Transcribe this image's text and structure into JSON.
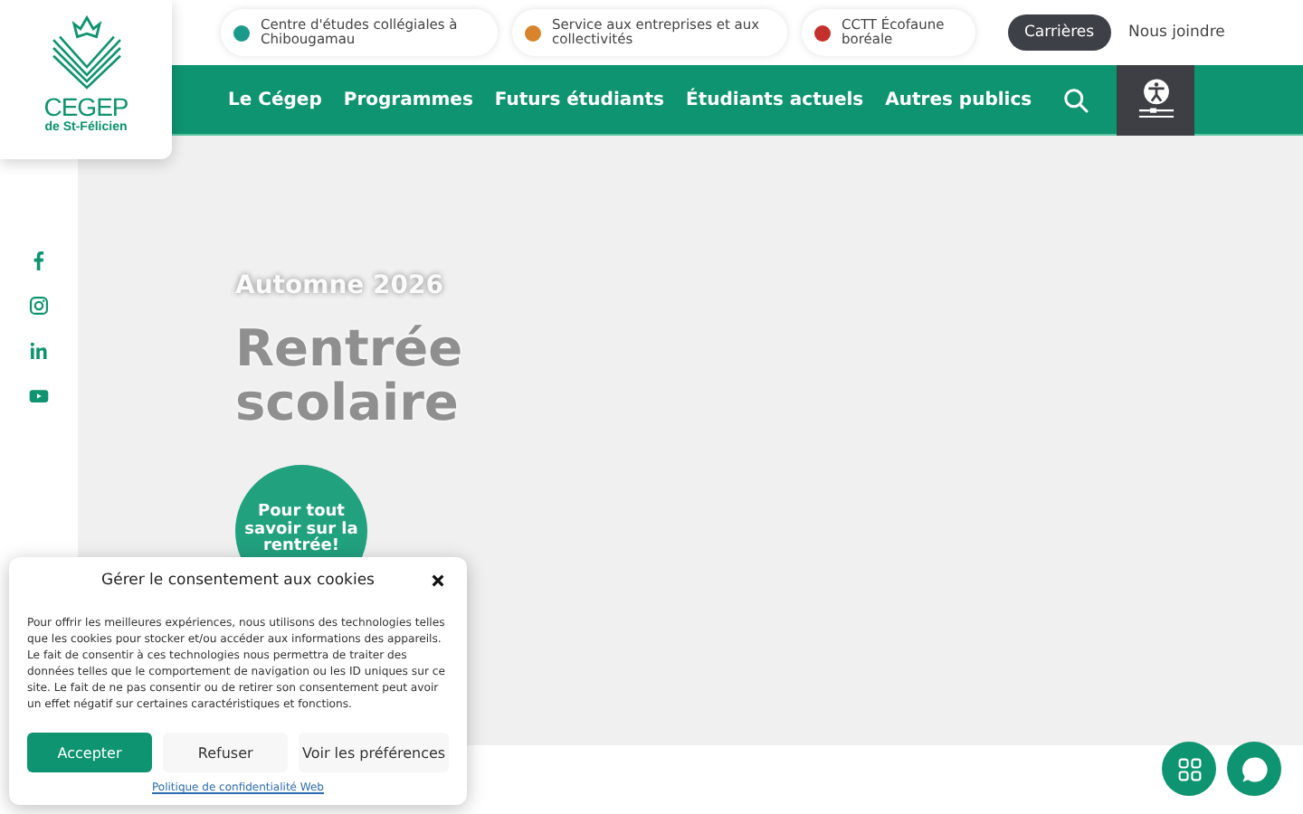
{
  "logo": {
    "name": "CEGEP",
    "subtitle": "de St-Félicien"
  },
  "top_links": [
    {
      "label": "Centre d'études collégiales à Chibougamau",
      "color": "#1b9a8c"
    },
    {
      "label": "Service aux entreprises et aux collectivités",
      "color": "#d8842c"
    },
    {
      "label": "CCTT Écofaune boréale",
      "color": "#c4302b"
    }
  ],
  "top_buttons": [
    {
      "label": "Carrières",
      "kind": "pill"
    },
    {
      "label": "Nous joindre",
      "kind": "link"
    }
  ],
  "nav": {
    "items": [
      "Le Cégep",
      "Programmes",
      "Futurs étudiants",
      "Étudiants actuels",
      "Autres publics"
    ]
  },
  "hero": {
    "eyebrow": "Automne 2026",
    "title": "Rentrée scolaire",
    "cta": "Pour tout savoir sur la rentrée!"
  },
  "cookie": {
    "title": "Gérer le consentement aux cookies",
    "text": "Pour offrir les meilleures expériences, nous utilisons des technologies telles que les cookies pour stocker et/ou accéder aux informations des appareils. Le fait de consentir à ces technologies nous permettra de traiter des données telles que le comportement de navigation ou les ID uniques sur ce site. Le fait de ne pas consentir ou de retirer son consentement peut avoir un effet négatif sur certaines caractéristiques et fonctions.",
    "buttons": [
      {
        "label": "Accepter",
        "kind": "primary"
      },
      {
        "label": "Refuser",
        "kind": "secondary"
      },
      {
        "label": "Voir les préférences",
        "kind": "secondary"
      }
    ],
    "link": "Politique de confidentialité Web"
  }
}
